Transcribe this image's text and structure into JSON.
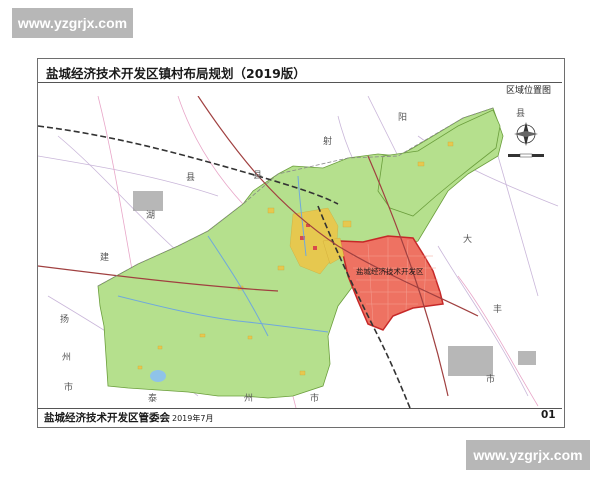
{
  "watermark_top": "www.yzgrjx.com",
  "watermark_bottom": "www.yzgrjx.com",
  "title": "盐城经济技术开发区镇村布局规划（2019版）",
  "subtitle": "区域位置图",
  "footer": {
    "organization": "盐城经济技术开发区管委会",
    "date": "2019年7月",
    "page": "01"
  },
  "map": {
    "zone_label": "盐城经济技术开发区",
    "place_labels": {
      "she": "射",
      "yang_n": "阳",
      "xian_n": "县",
      "xian_left": "县",
      "hu": "湖",
      "jian": "建",
      "yang_w": "扬",
      "zhou_w": "州",
      "shi_w": "市",
      "da": "大",
      "feng": "丰",
      "shi_e": "市",
      "tai": "泰",
      "zhou_s": "州",
      "shi_s": "市",
      "xian_e": "县"
    },
    "colors": {
      "zone_fill": "#ee7262",
      "zone_border": "#c62828",
      "green_area": "#b5e08d",
      "urban": "#e6c84f",
      "river": "#6fa8dc",
      "railway": "#333333",
      "background": "#ffffff"
    },
    "icons": [
      "compass-icon",
      "scale-bar-icon"
    ]
  }
}
